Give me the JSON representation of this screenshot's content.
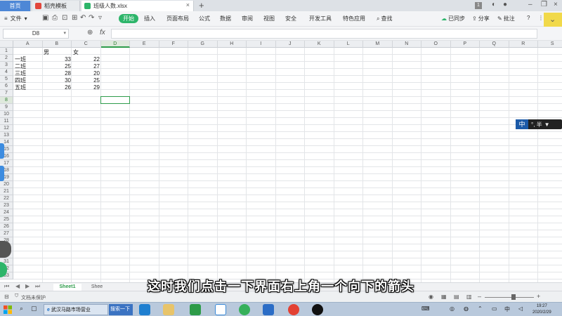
{
  "tabs": {
    "home": "首页",
    "template": "稻壳模板",
    "file": "班级人数.xlsx"
  },
  "window": {
    "badge": "1"
  },
  "menu": {
    "file": "文件",
    "start": "开始",
    "items": [
      "插入",
      "页面布局",
      "公式",
      "数据",
      "审阅",
      "视图",
      "安全",
      "开发工具",
      "特色应用"
    ],
    "search": "查找",
    "sync": "已同步",
    "share": "分享",
    "annotate": "批注"
  },
  "formula": {
    "name_box": "D8",
    "fx": "fx",
    "value": ""
  },
  "columns": [
    "A",
    "B",
    "C",
    "D",
    "E",
    "F",
    "G",
    "H",
    "I",
    "J",
    "K",
    "L",
    "M",
    "N",
    "O",
    "P",
    "Q",
    "R",
    "S"
  ],
  "selected": {
    "column": "D",
    "row": 8
  },
  "rows": [
    1,
    2,
    3,
    4,
    5,
    6,
    7,
    8,
    9,
    10,
    11,
    12,
    13,
    14,
    15,
    16,
    17,
    18,
    19,
    20,
    21,
    22,
    23,
    24,
    25,
    26,
    27,
    28,
    29,
    30,
    31,
    32,
    33
  ],
  "table": {
    "headers": [
      "男",
      "女"
    ],
    "data": [
      {
        "label": "一班",
        "male": 33,
        "female": 22
      },
      {
        "label": "二班",
        "male": 25,
        "female": 27
      },
      {
        "label": "三班",
        "male": 28,
        "female": 20
      },
      {
        "label": "四班",
        "male": 30,
        "female": 25
      },
      {
        "label": "五班",
        "male": 26,
        "female": 29
      }
    ]
  },
  "ime": {
    "mode": "中",
    "rest": "°, 半"
  },
  "sheets": [
    "Sheet1",
    "Shee"
  ],
  "status": {
    "protect": "文档未保护"
  },
  "subtitle": "这时我们点击一下界面右上角一个向下的箭头",
  "taskbar": {
    "ie_app": "武汉马路市场营业",
    "search": "搜索一下",
    "clock_time": "19:27",
    "clock_date": "2020/2/29",
    "lang": "中"
  },
  "colors": {
    "accent_green": "#2e9c4b",
    "tab_blue": "#4d87d6",
    "start_green": "#2db56a"
  }
}
